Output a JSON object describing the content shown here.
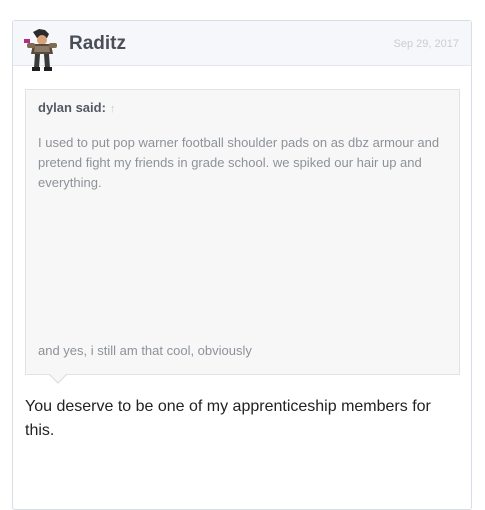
{
  "post": {
    "username": "Raditz",
    "date": "Sep 29, 2017",
    "quote": {
      "author": "dylan said:",
      "up_arrow": "↑",
      "text": "I used to put pop warner football shoulder pads on as dbz armour and pretend fight my friends in grade school. we spiked our hair up and everything.",
      "tail": "and yes, i still am that cool, obviously"
    },
    "message": "You deserve to be one of my apprenticeship members for this."
  },
  "colors": {
    "header_bg": "#f5f7fa",
    "quote_bg": "#f7f7f7",
    "border": "#d8dde6",
    "username": "#4a4f57",
    "quote_text": "#8d9299"
  },
  "icons": {
    "avatar": "raditz-avatar-image",
    "quote_jump": "arrow-up-icon"
  }
}
